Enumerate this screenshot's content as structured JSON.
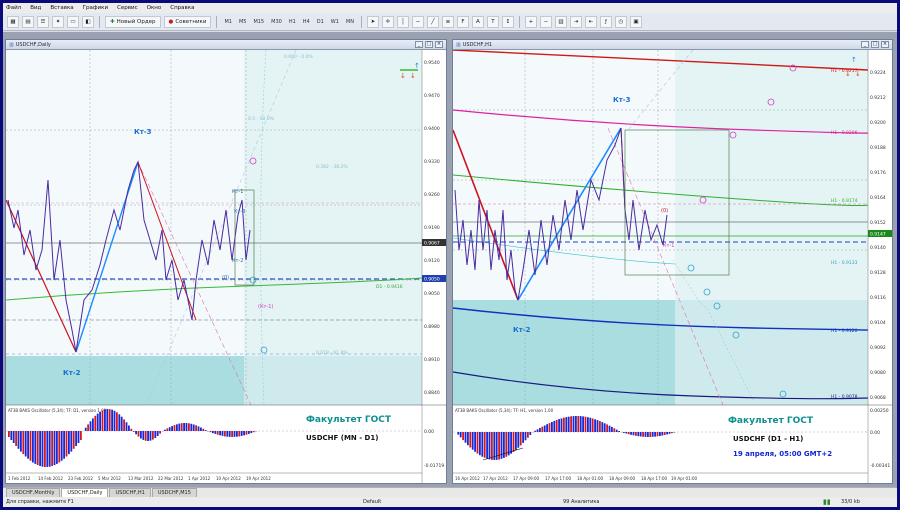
{
  "menu": [
    "Файл",
    "Вид",
    "Вставка",
    "Графики",
    "Сервис",
    "Окно",
    "Справка"
  ],
  "toolbar": {
    "new_order": "Новый Ордер",
    "advisors": "Советники",
    "timeframes": [
      "M1",
      "M5",
      "M15",
      "M30",
      "H1",
      "H4",
      "D1",
      "W1",
      "MN"
    ]
  },
  "left_chart": {
    "title": "USDCHF,Daily",
    "labels": {
      "kt3": "Кт-3",
      "kt2": "Кт-2",
      "kt1": "Кт-1",
      "k2": "Кт-2",
      "kt1p": "(Кт-1)",
      "zero": "(0)",
      "kt_small": "Кт-3"
    },
    "caption1": "Факультет ГОСТ",
    "caption2": "USDCHF (MN - D1)",
    "price_ticks": [
      "0.9540",
      "0.9470",
      "0.9400",
      "0.9330",
      "0.9260",
      "0.9190",
      "0.9120",
      "0.9050",
      "0.8980",
      "0.8910",
      "0.8840"
    ],
    "current_price": "0.9067",
    "dashed_price": "0.9050",
    "osc_title": "AT3B BAKS Oscillator (5,34); TF: D1, version 1.00",
    "osc_ticks": [
      "0.00",
      "-0.01719"
    ],
    "date_ticks": [
      "1 Feb 2012",
      "14 Feb 2012",
      "23 Feb 2012",
      "5 Mar 2012",
      "13 Mar 2012",
      "22 Mar 2012",
      "1 Apr 2012",
      "10 Apr 2012",
      "19 Apr 2012"
    ],
    "fib_labels": [
      "0.000 - 0.0%",
      "0.382 - 38.2%",
      "0.5 - 50.0%",
      "0.618 - 61.8%",
      "D1 - 0.9416"
    ]
  },
  "right_chart": {
    "title": "USDCHF,H1",
    "labels": {
      "kt3": "Кт-3",
      "kt2": "Кт-2",
      "zero": "(0)",
      "kt1": "Кт-1"
    },
    "caption1": "Факультет ГОСТ",
    "caption2": "USDCHF (D1 - H1)",
    "caption3": "19 апреля, 05:00 GMT+2",
    "price_ticks": [
      "0.9224",
      "0.9212",
      "0.9200",
      "0.9188",
      "0.9176",
      "0.9164",
      "0.9152",
      "0.9140",
      "0.9128",
      "0.9116",
      "0.9104",
      "0.9092",
      "0.9080",
      "0.9068"
    ],
    "current_price": "0.9147",
    "osc_title": "AT3B BAKS Oscillator (5,34); TF: H1, version 1.00",
    "osc_ticks": [
      "0.00250",
      "0.00",
      "-0.00341"
    ],
    "date_ticks": [
      "16 Apr 2012",
      "17 Apr 2012",
      "17 Apr 09:00",
      "17 Apr 17:00",
      "18 Apr 01:00",
      "18 Apr 09:00",
      "18 Apr 17:00",
      "19 Apr 01:00"
    ],
    "line_labels": [
      "H1 - 0.9217",
      "H1 - 0.9206",
      "H1 - 0.9174",
      "H1 - 0.9133",
      "H1 - 0.9120",
      "H1 - 0.9078"
    ]
  },
  "tabs": [
    "USDCHF,Monthly",
    "USDCHF,Daily",
    "USDCHF,H1",
    "USDCHF,M15"
  ],
  "active_tab": "USDCHF,Daily",
  "status": {
    "help": "Для справки, нажмите F1",
    "default": "Default",
    "bars": "99 Аналитика",
    "kb": "33/0 kb"
  },
  "colors": {
    "up": "#1f74ff",
    "down": "#e0102a",
    "teal_zone": "#9fd7dc",
    "caption": "#0f8f8f",
    "bg": "#0a0a78"
  }
}
